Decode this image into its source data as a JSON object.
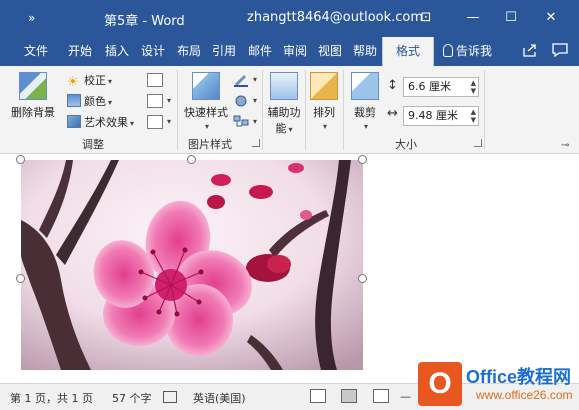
{
  "titlebar": {
    "qat": "»",
    "title": "第5章 - Word",
    "account": "zhangtt8464@outlook.com",
    "buttons": {
      "ribbon_options": "⊡",
      "minimize": "—",
      "maximize": "☐",
      "close": "✕"
    }
  },
  "tabs": [
    {
      "label": "文件"
    },
    {
      "label": "开始"
    },
    {
      "label": "插入"
    },
    {
      "label": "设计"
    },
    {
      "label": "布局"
    },
    {
      "label": "引用"
    },
    {
      "label": "邮件"
    },
    {
      "label": "审阅"
    },
    {
      "label": "视图"
    },
    {
      "label": "帮助"
    },
    {
      "label": "格式",
      "active": true
    }
  ],
  "tellme": "告诉我",
  "ribbon": {
    "adjust": {
      "remove_bg": "删除背景",
      "corrections": "校正",
      "color": "颜色",
      "artistic": "艺术效果",
      "label": "调整"
    },
    "picture_styles": {
      "quick_styles": "快速样式",
      "label": "图片样式"
    },
    "accessibility": {
      "alt_text_line1": "辅助功",
      "alt_text_line2": "能"
    },
    "arrange": {
      "label": "排列"
    },
    "size": {
      "crop": "裁剪",
      "height": "6.6 厘米",
      "width": "9.48 厘米",
      "label": "大小"
    }
  },
  "statusbar": {
    "page": "第 1 页，共 1 页",
    "words": "57 个字",
    "language": "英语(美国)",
    "zoom_minus": "—",
    "zoom_plus": "+"
  },
  "watermark": {
    "logo_letter": "O",
    "brand": "Office教程网",
    "site": "www.office26.com"
  },
  "colors": {
    "accent": "#2b579a",
    "ribbon_bg": "#f3f3f3",
    "watermark_orange": "#e8571f",
    "watermark_blue": "#1c6fd1"
  }
}
